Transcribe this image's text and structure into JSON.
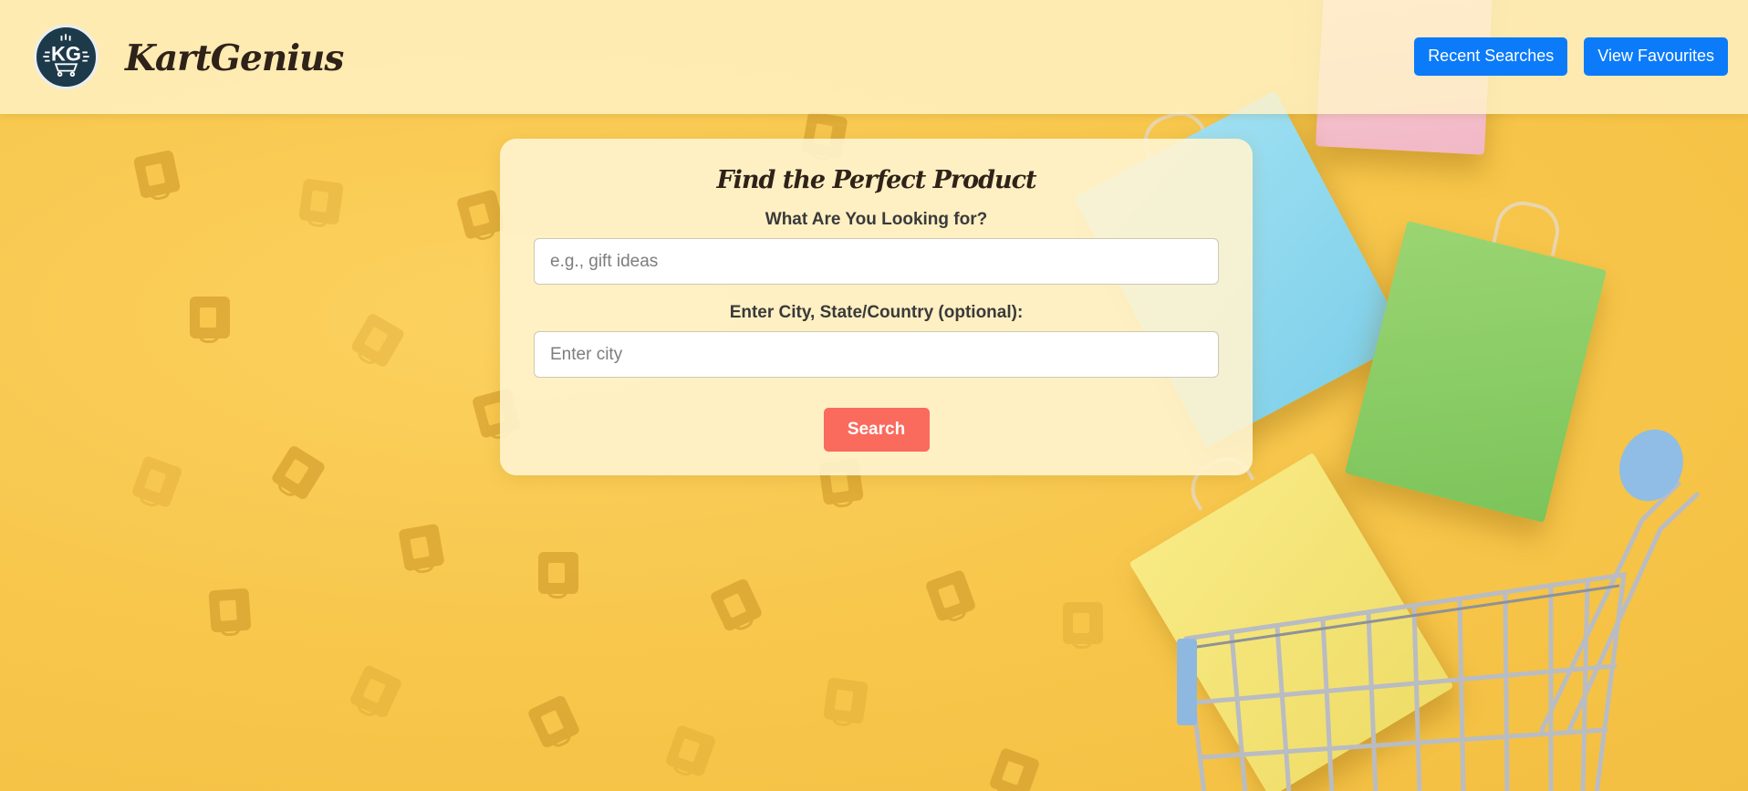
{
  "header": {
    "logo_text": "KG",
    "brand": "KartGenius",
    "actions": [
      {
        "label": "Recent Searches"
      },
      {
        "label": "View Favourites"
      }
    ]
  },
  "search_card": {
    "title": "Find the Perfect Product",
    "query": {
      "label": "What Are You Looking for?",
      "placeholder": "e.g., gift ideas",
      "value": ""
    },
    "location": {
      "label": "Enter City, State/Country (optional):",
      "placeholder": "Enter city",
      "value": ""
    },
    "submit_label": "Search"
  },
  "background": {
    "scene": "shopping-bags-and-cart-icon",
    "pattern": "shopping-bag-icon"
  },
  "colors": {
    "background": "#f7c94e",
    "header": "#fff3c8",
    "primary_button": "#0b7bfa",
    "search_button": "#fa6a5d",
    "text_dark": "#2e2219"
  }
}
